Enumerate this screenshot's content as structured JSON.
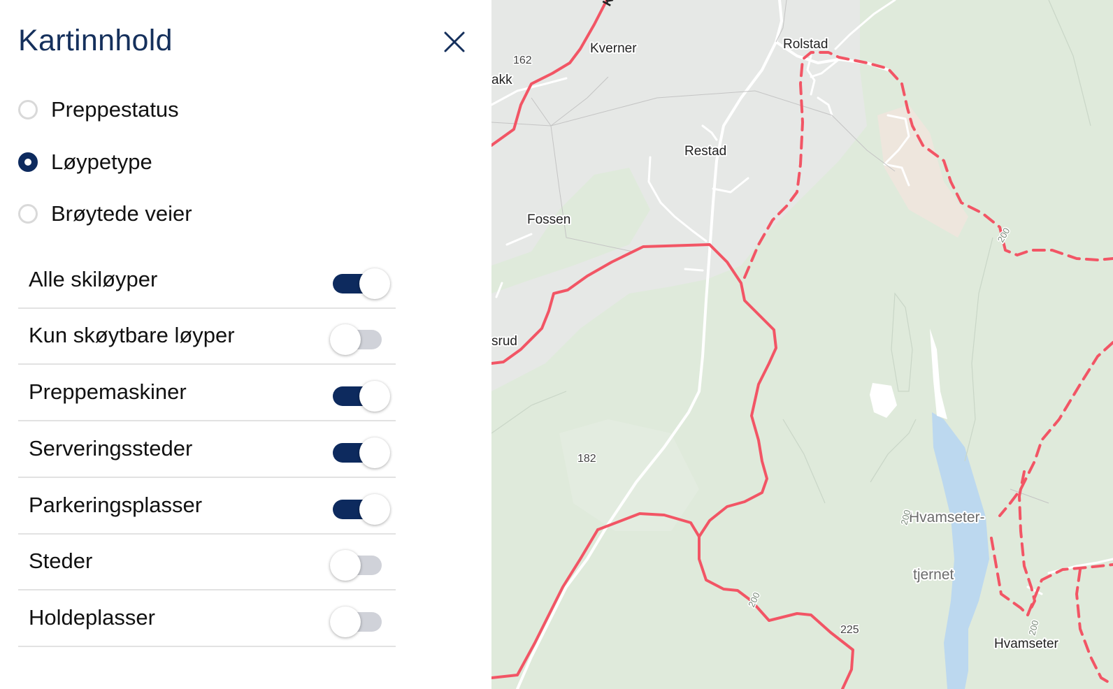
{
  "panel": {
    "title": "Kartinnhold",
    "radios": [
      {
        "label": "Preppestatus",
        "checked": false
      },
      {
        "label": "Løypetype",
        "checked": true
      },
      {
        "label": "Brøytede veier",
        "checked": false
      }
    ],
    "toggles": [
      {
        "label": "Alle skiløyper",
        "on": true
      },
      {
        "label": "Kun skøytbare løyper",
        "on": false
      },
      {
        "label": "Preppemaskiner",
        "on": true
      },
      {
        "label": "Serveringssteder",
        "on": true
      },
      {
        "label": "Parkeringsplasser",
        "on": true
      },
      {
        "label": "Steder",
        "on": false
      },
      {
        "label": "Holdeplasser",
        "on": false
      }
    ]
  },
  "map": {
    "places": {
      "kverner": "Kverner",
      "rolstad": "Rolstad",
      "akk": "akk",
      "restad": "Restad",
      "fossen": "Fossen",
      "srud": "srud",
      "hvamseter_tjernet_1": "Hvamseter-",
      "hvamseter_tjernet_2": "tjernet",
      "hvamseter": "Hvamseter"
    },
    "elevations": {
      "e162": "162",
      "e182": "182",
      "e225": "225",
      "c200_a": "200",
      "c200_b": "200",
      "c200_c": "200",
      "c200_d": "200"
    },
    "colors": {
      "trail": "#f25565",
      "map_background": "#e6e8e6",
      "forest": "#dfeadb",
      "water": "#bcd8ef",
      "accent": "#0d2a5e"
    }
  }
}
